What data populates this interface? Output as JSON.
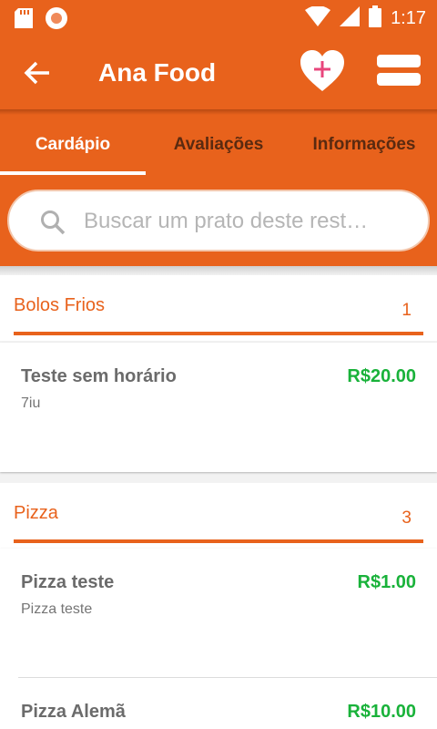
{
  "status_bar": {
    "time": "1:17"
  },
  "app_bar": {
    "title": "Ana Food"
  },
  "tabs": [
    {
      "label": "Cardápio",
      "active": true
    },
    {
      "label": "Avaliações",
      "active": false
    },
    {
      "label": "Informações",
      "active": false
    }
  ],
  "search": {
    "placeholder": "Buscar um prato deste rest…",
    "value": ""
  },
  "sections": [
    {
      "title": "Bolos Frios",
      "count": "1",
      "items": [
        {
          "name": "Teste sem horário",
          "description": "7iu",
          "price": "R$20.00"
        }
      ]
    },
    {
      "title": "Pizza",
      "count": "3",
      "items": [
        {
          "name": "Pizza teste",
          "description": "Pizza teste",
          "price": "R$1.00"
        },
        {
          "name": "Pizza Alemã",
          "description": "",
          "price": "R$10.00"
        }
      ]
    }
  ],
  "colors": {
    "accent": "#e8621c",
    "price": "#19b23a",
    "favorite_plus": "#e8467c"
  },
  "icons": [
    "sd-card-icon",
    "record-icon",
    "wifi-icon",
    "signal-icon",
    "battery-icon",
    "back-arrow-icon",
    "favorite-add-icon",
    "menu-icon",
    "search-icon"
  ]
}
